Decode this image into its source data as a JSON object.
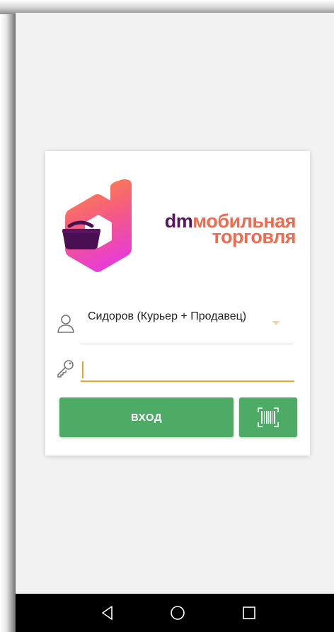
{
  "brand": {
    "dm": "dm",
    "line1_rest": "мобильная",
    "line2": "торговля"
  },
  "login": {
    "user_name": "Сидоров (Курьер + Продавец)",
    "password_value": "",
    "login_label": "ВХОД"
  },
  "icons": {
    "user": "person-outline-icon",
    "key": "key-icon",
    "barcode": "barcode-scan-icon",
    "dropdown": "triangle-down-icon",
    "back": "back-triangle-icon",
    "home": "home-circle-icon",
    "recents": "recents-square-icon"
  },
  "colors": {
    "accent_green": "#4dab65",
    "input_underline": "#f0a12e",
    "brand_purple": "#5a1360",
    "brand_orange": "#f06a4f"
  }
}
